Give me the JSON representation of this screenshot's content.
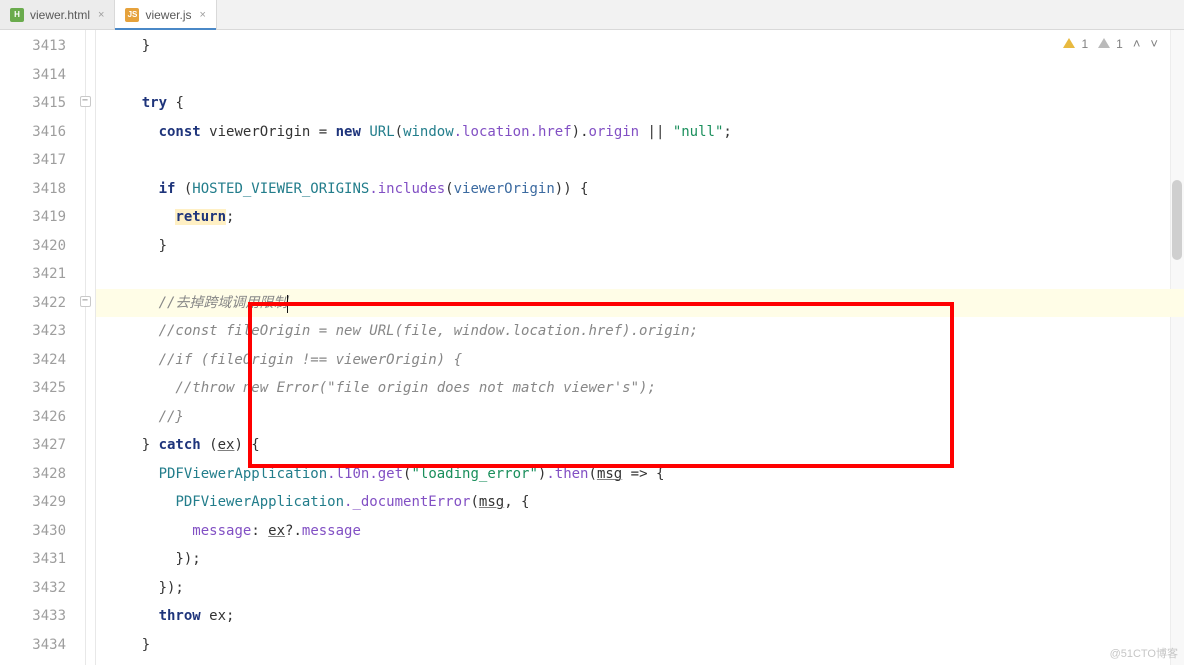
{
  "tabs": [
    {
      "label": "viewer.html",
      "icon": "H",
      "icon_class": "html",
      "active": false
    },
    {
      "label": "viewer.js",
      "icon": "JS",
      "icon_class": "js",
      "active": true
    }
  ],
  "warnings": {
    "yellow_count": "1",
    "grey_count": "1"
  },
  "line_start": 3413,
  "current_line": 3422,
  "code": {
    "l3414": "",
    "l3415_try": "try",
    "l3416_const": "const",
    "l3416_var": "viewerOrigin",
    "l3416_eq": " = ",
    "l3416_new": "new",
    "l3416_url": " URL",
    "l3416_p1": "(",
    "l3416_window": "window",
    "l3416_loc": ".location",
    "l3416_href": ".href",
    "l3416_p2": ").",
    "l3416_origin": "origin",
    "l3416_or": " || ",
    "l3416_str": "\"null\"",
    "l3416_end": ";",
    "l3418_if": "if",
    "l3418_p1": " (",
    "l3418_const": "HOSTED_VIEWER_ORIGINS",
    "l3418_inc": ".includes",
    "l3418_p2": "(",
    "l3418_arg": "viewerOrigin",
    "l3418_p3": ")) {",
    "l3419_return": "return",
    "l3419_semi": ";",
    "l3420_brace": "}",
    "l3422_c": "//去掉跨域调用限制",
    "l3423_c": "//const fileOrigin = new URL(file, window.location.href).origin;",
    "l3424_c": "//if (fileOrigin !== viewerOrigin) {",
    "l3425_c": "  //throw new Error(\"file origin does not match viewer's\");",
    "l3426_c": "//}",
    "l3427_catch": "catch",
    "l3427_ex": "ex",
    "l3428_pdf": "PDFViewerApplication",
    "l3428_l10n": ".l10n",
    "l3428_get": ".get",
    "l3428_str": "\"loading_error\"",
    "l3428_then": ".then",
    "l3428_msg": "msg",
    "l3429_pdf": "PDFViewerApplication",
    "l3429_doc": "._documentError",
    "l3429_msg": "msg",
    "l3430_key": "message",
    "l3430_ex": "ex",
    "l3430_opt": "?.",
    "l3430_msg": "message",
    "l3431_close": "});",
    "l3432_close": "});",
    "l3433_throw": "throw",
    "l3433_ex": " ex;",
    "l3434_brace": "}"
  },
  "watermark": "@51CTO博客"
}
